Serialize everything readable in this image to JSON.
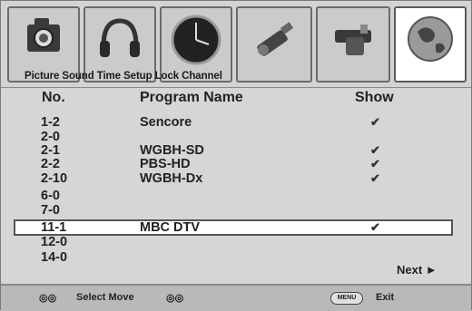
{
  "tabs": [
    {
      "name": "Picture",
      "icon": "camera-icon"
    },
    {
      "name": "Sound",
      "icon": "headphones-icon"
    },
    {
      "name": "Time",
      "icon": "clock-icon"
    },
    {
      "name": "Setup",
      "icon": "connector-icon"
    },
    {
      "name": "Lock",
      "icon": "lock-icon"
    },
    {
      "name": "Channel",
      "icon": "globe-icon"
    }
  ],
  "tab_labels_text": "Picture Sound Time Setup Lock Channel",
  "active_tab": "Channel",
  "table": {
    "headers": {
      "no": "No.",
      "program": "Program Name",
      "show": "Show"
    },
    "rows": [
      {
        "no": "1-2",
        "program": "Sencore",
        "show": "✔"
      },
      {
        "no": "2-0",
        "program": "",
        "show": ""
      },
      {
        "no": "2-1",
        "program": "WGBH-SD",
        "show": "✔"
      },
      {
        "no": "2-2",
        "program": "PBS-HD",
        "show": "✔"
      },
      {
        "no": "2-10",
        "program": "WGBH-Dx",
        "show": "✔"
      },
      {
        "no": "6-0",
        "program": "",
        "show": ""
      },
      {
        "no": "7-0",
        "program": "",
        "show": ""
      },
      {
        "no": "11-1",
        "program": "MBC DTV",
        "show": "✔"
      },
      {
        "no": "12-0",
        "program": "",
        "show": ""
      },
      {
        "no": "14-0",
        "program": "",
        "show": ""
      }
    ],
    "selected_row": 7
  },
  "next_label": "Next ►",
  "footer": {
    "select_move": "Select Move",
    "menu_key": "MENU",
    "exit": "Exit"
  }
}
